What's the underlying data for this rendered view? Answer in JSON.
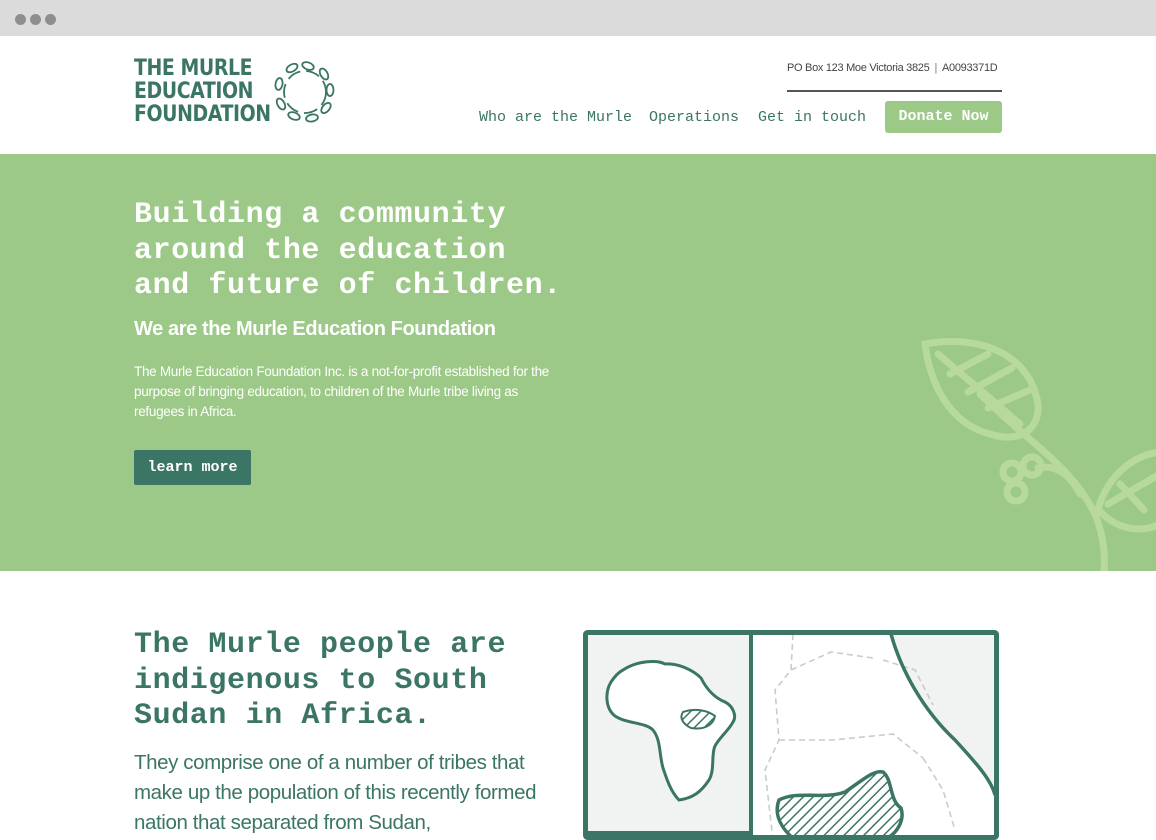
{
  "browser": {
    "dots": [
      "window-dot",
      "window-dot",
      "window-dot"
    ]
  },
  "header": {
    "logo_lines": [
      "THE MURLE",
      "EDUCATION",
      "FOUNDATION"
    ],
    "logo_icon": "leaf-wreath-icon",
    "contact": {
      "address": "PO Box 123 Moe Victoria 3825",
      "separator": "|",
      "reg_number": "A0093371D"
    },
    "nav": [
      {
        "label": "Who are the Murle"
      },
      {
        "label": "Operations"
      },
      {
        "label": "Get in touch"
      }
    ],
    "donate_label": "Donate Now"
  },
  "hero": {
    "title_lines": [
      "Building a community",
      "around the education",
      "and future of children."
    ],
    "subtitle": "We are the Murle Education Foundation",
    "body": "The Murle Education Foundation Inc. is a not-for-profit established for the purpose of bringing education, to children of the Murle tribe living as refugees in Africa.",
    "button_label": "learn more",
    "decoration_icon": "plant-leaves-icon"
  },
  "section2": {
    "title_lines": [
      "The Murle people are",
      "indigenous to South",
      "Sudan in Africa."
    ],
    "body": "They comprise one of a number of tribes that make up the population of this recently formed nation that separated from Sudan,",
    "map_icon": "africa-south-sudan-map-icon"
  },
  "colors": {
    "brand_green": "#3b7565",
    "hero_green": "#9cc987",
    "leaf_light": "#b8d99c",
    "map_bg": "#f1f2f2"
  }
}
